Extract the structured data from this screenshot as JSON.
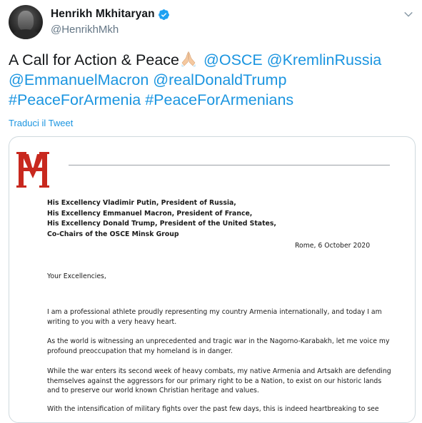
{
  "author": {
    "display_name": "Henrikh Mkhitaryan",
    "handle": "@HenrikhMkh"
  },
  "tweet": {
    "text_lead": "A Call for Action & Peace",
    "emoji_icon": "folded-hands-icon",
    "mentions": [
      "@OSCE",
      "@KremlinRussia",
      "@EmmanuelMacron",
      "@realDonaldTrump"
    ],
    "hashtags": [
      "#PeaceForArmenia",
      "#PeaceForArmenians"
    ],
    "translate_label": "Traduci il Tweet"
  },
  "letter": {
    "recipients": [
      "His Excellency Vladimir Putin, President of Russia,",
      "His Excellency Emmanuel Macron, President of France,",
      "His Excellency Donald Trump, President of the United States,",
      "Co-Chairs of the OSCE Minsk Group"
    ],
    "date": "Rome, 6 October 2020",
    "salutation": "Your Excellencies,",
    "paragraphs": [
      {
        "line1": "I am a professional athlete proudly representing my country Armenia internationally, and today I am",
        "line2": "writing to you with a very heavy heart."
      },
      {
        "line1": "As the world is witnessing an unprecedented and tragic war in the Nagorno-Karabakh, let me voice my",
        "line2": "profound preoccupation that my homeland is in danger."
      },
      {
        "line1": "While the war enters its second week of heavy combats, my native Armenia and Artsakh are defending",
        "line2": "themselves against the aggressors for our primary right to be a Nation, to exist on our historic lands",
        "line3": "and to preserve our world known Christian heritage and values."
      },
      {
        "line1": "With the intensification of military fights over the past few days, this is indeed heartbreaking to see"
      }
    ]
  },
  "colors": {
    "link": "#1b95e0",
    "text": "#14171a",
    "secondary": "#657786",
    "verified": "#1da1f2",
    "logo_red": "#c8281e"
  }
}
